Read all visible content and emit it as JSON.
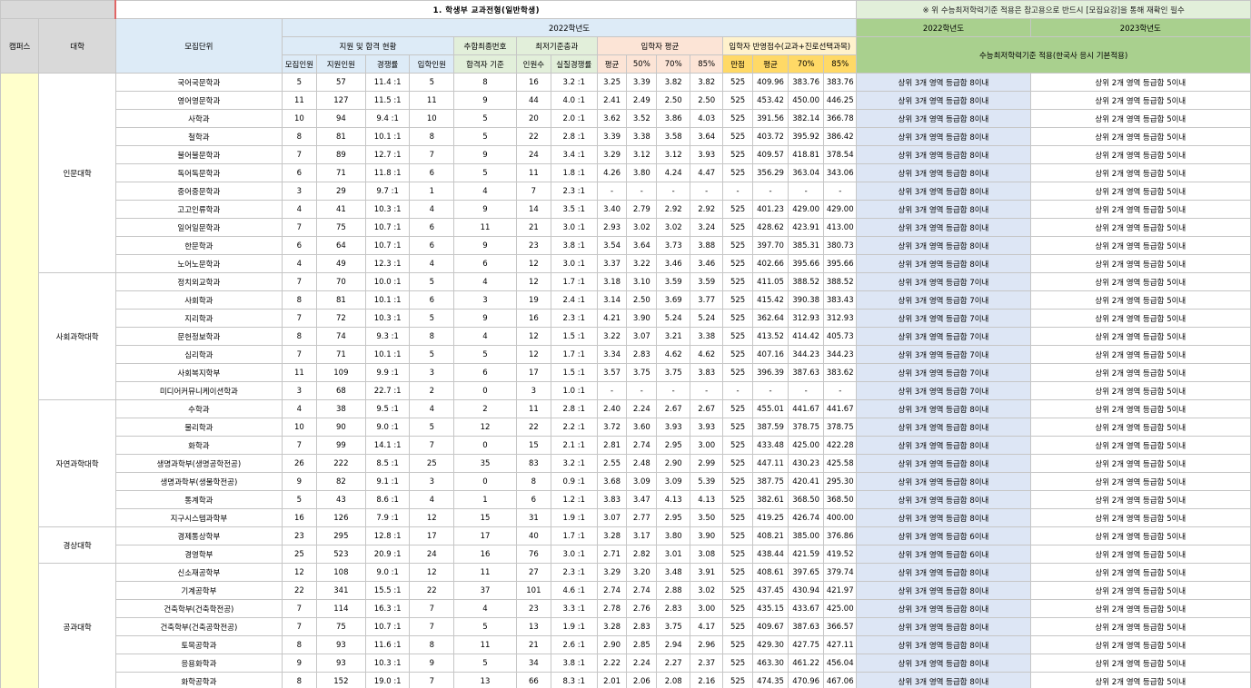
{
  "title": "1. 학생부 교과전형(일반학생)",
  "note": "※ 위 수능최저학력기준 적용은 참고용으로 반드시 [모집요강]을 통해 재확인 필수",
  "headers": {
    "campus": "캠퍼스",
    "college": "대학",
    "unit": "모집단위",
    "year2022": "2022학년도",
    "apply_group": "지원 및 합격 현황",
    "extra_group": "추합최종번호",
    "min_group": "최저기준충과",
    "avg_group": "입학자 평균",
    "score_group": "입학자 반영점수(교과+진로선택과목)",
    "recruit": "모집인원",
    "applicants": "지원인원",
    "ratio": "경쟁률",
    "admitted": "입학인원",
    "pass_base": "합격자 기준",
    "min_count": "인원수",
    "real_ratio": "실질경쟁률",
    "avg": "평균",
    "p50": "50%",
    "p70": "70%",
    "p85": "85%",
    "full": "만점",
    "savg": "평균",
    "s70": "70%",
    "s85": "85%",
    "csat2022": "2022학년도",
    "csat2023": "2023학년도",
    "csat_span": "수능최저학력기준 적용(한국사 응시 기본적용)"
  },
  "colleges": [
    {
      "name": "인문대학",
      "rows": [
        [
          "국어국문학과",
          "5",
          "57",
          "11.4 :1",
          "5",
          "8",
          "16",
          "3.2 :1",
          "3.25",
          "3.39",
          "3.82",
          "3.82",
          "525",
          "409.96",
          "383.76",
          "383.76",
          "상위 3개 영역 등급합 8이내",
          "상위 2개 영역 등급합 5이내"
        ],
        [
          "영어영문학과",
          "11",
          "127",
          "11.5 :1",
          "11",
          "9",
          "44",
          "4.0 :1",
          "2.41",
          "2.49",
          "2.50",
          "2.50",
          "525",
          "453.42",
          "450.00",
          "446.25",
          "상위 3개 영역 등급합 8이내",
          "상위 2개 영역 등급합 5이내"
        ],
        [
          "사학과",
          "10",
          "94",
          "9.4 :1",
          "10",
          "5",
          "20",
          "2.0 :1",
          "3.62",
          "3.52",
          "3.86",
          "4.03",
          "525",
          "391.56",
          "382.14",
          "366.78",
          "상위 3개 영역 등급합 8이내",
          "상위 2개 영역 등급합 5이내"
        ],
        [
          "철학과",
          "8",
          "81",
          "10.1 :1",
          "8",
          "5",
          "22",
          "2.8 :1",
          "3.39",
          "3.38",
          "3.58",
          "3.64",
          "525",
          "403.72",
          "395.92",
          "386.42",
          "상위 3개 영역 등급합 8이내",
          "상위 2개 영역 등급합 5이내"
        ],
        [
          "불어불문학과",
          "7",
          "89",
          "12.7 :1",
          "7",
          "9",
          "24",
          "3.4 :1",
          "3.29",
          "3.12",
          "3.12",
          "3.93",
          "525",
          "409.57",
          "418.81",
          "378.54",
          "상위 3개 영역 등급합 8이내",
          "상위 2개 영역 등급합 5이내"
        ],
        [
          "독어독문학과",
          "6",
          "71",
          "11.8 :1",
          "6",
          "5",
          "11",
          "1.8 :1",
          "4.26",
          "3.80",
          "4.24",
          "4.47",
          "525",
          "356.29",
          "363.04",
          "343.06",
          "상위 3개 영역 등급합 8이내",
          "상위 2개 영역 등급합 5이내"
        ],
        [
          "중어중문학과",
          "3",
          "29",
          "9.7 :1",
          "1",
          "4",
          "7",
          "2.3 :1",
          "-",
          "-",
          "-",
          "-",
          "-",
          "-",
          "-",
          "-",
          "상위 3개 영역 등급합 8이내",
          "상위 2개 영역 등급합 5이내"
        ],
        [
          "고고인류학과",
          "4",
          "41",
          "10.3 :1",
          "4",
          "9",
          "14",
          "3.5 :1",
          "3.40",
          "2.79",
          "2.92",
          "2.92",
          "525",
          "401.23",
          "429.00",
          "429.00",
          "상위 3개 영역 등급합 8이내",
          "상위 2개 영역 등급합 5이내"
        ],
        [
          "일어일문학과",
          "7",
          "75",
          "10.7 :1",
          "6",
          "11",
          "21",
          "3.0 :1",
          "2.93",
          "3.02",
          "3.02",
          "3.24",
          "525",
          "428.62",
          "423.91",
          "413.00",
          "상위 3개 영역 등급합 8이내",
          "상위 2개 영역 등급합 5이내"
        ],
        [
          "한문학과",
          "6",
          "64",
          "10.7 :1",
          "6",
          "9",
          "23",
          "3.8 :1",
          "3.54",
          "3.64",
          "3.73",
          "3.88",
          "525",
          "397.70",
          "385.31",
          "380.73",
          "상위 3개 영역 등급합 8이내",
          "상위 2개 영역 등급합 5이내"
        ],
        [
          "노어노문학과",
          "4",
          "49",
          "12.3 :1",
          "4",
          "6",
          "12",
          "3.0 :1",
          "3.37",
          "3.22",
          "3.46",
          "3.46",
          "525",
          "402.66",
          "395.66",
          "395.66",
          "상위 3개 영역 등급합 8이내",
          "상위 2개 영역 등급합 5이내"
        ]
      ]
    },
    {
      "name": "사회과학대학",
      "rows": [
        [
          "정치외교학과",
          "7",
          "70",
          "10.0 :1",
          "5",
          "4",
          "12",
          "1.7 :1",
          "3.18",
          "3.10",
          "3.59",
          "3.59",
          "525",
          "411.05",
          "388.52",
          "388.52",
          "상위 3개 영역 등급합 7이내",
          "상위 2개 영역 등급합 5이내"
        ],
        [
          "사회학과",
          "8",
          "81",
          "10.1 :1",
          "6",
          "3",
          "19",
          "2.4 :1",
          "3.14",
          "2.50",
          "3.69",
          "3.77",
          "525",
          "415.42",
          "390.38",
          "383.43",
          "상위 3개 영역 등급합 7이내",
          "상위 2개 영역 등급합 5이내"
        ],
        [
          "지리학과",
          "7",
          "72",
          "10.3 :1",
          "5",
          "9",
          "16",
          "2.3 :1",
          "4.21",
          "3.90",
          "5.24",
          "5.24",
          "525",
          "362.64",
          "312.93",
          "312.93",
          "상위 3개 영역 등급합 7이내",
          "상위 2개 영역 등급합 5이내"
        ],
        [
          "문헌정보학과",
          "8",
          "74",
          "9.3 :1",
          "8",
          "4",
          "12",
          "1.5 :1",
          "3.22",
          "3.07",
          "3.21",
          "3.38",
          "525",
          "413.52",
          "414.42",
          "405.73",
          "상위 3개 영역 등급합 7이내",
          "상위 2개 영역 등급합 5이내"
        ],
        [
          "심리학과",
          "7",
          "71",
          "10.1 :1",
          "5",
          "5",
          "12",
          "1.7 :1",
          "3.34",
          "2.83",
          "4.62",
          "4.62",
          "525",
          "407.16",
          "344.23",
          "344.23",
          "상위 3개 영역 등급합 7이내",
          "상위 2개 영역 등급합 5이내"
        ],
        [
          "사회복지학부",
          "11",
          "109",
          "9.9 :1",
          "3",
          "6",
          "17",
          "1.5 :1",
          "3.57",
          "3.75",
          "3.75",
          "3.83",
          "525",
          "396.39",
          "387.63",
          "383.62",
          "상위 3개 영역 등급합 7이내",
          "상위 2개 영역 등급합 5이내"
        ],
        [
          "미디어커뮤니케이션학과",
          "3",
          "68",
          "22.7 :1",
          "2",
          "0",
          "3",
          "1.0 :1",
          "-",
          "-",
          "-",
          "-",
          "-",
          "-",
          "-",
          "-",
          "상위 3개 영역 등급합 7이내",
          "상위 2개 영역 등급합 5이내"
        ]
      ]
    },
    {
      "name": "자연과학대학",
      "rows": [
        [
          "수학과",
          "4",
          "38",
          "9.5 :1",
          "4",
          "2",
          "11",
          "2.8 :1",
          "2.40",
          "2.24",
          "2.67",
          "2.67",
          "525",
          "455.01",
          "441.67",
          "441.67",
          "상위 3개 영역 등급합 8이내",
          "상위 2개 영역 등급합 5이내"
        ],
        [
          "물리학과",
          "10",
          "90",
          "9.0 :1",
          "5",
          "12",
          "22",
          "2.2 :1",
          "3.72",
          "3.60",
          "3.93",
          "3.93",
          "525",
          "387.59",
          "378.75",
          "378.75",
          "상위 3개 영역 등급합 8이내",
          "상위 2개 영역 등급합 5이내"
        ],
        [
          "화학과",
          "7",
          "99",
          "14.1 :1",
          "7",
          "0",
          "15",
          "2.1 :1",
          "2.81",
          "2.74",
          "2.95",
          "3.00",
          "525",
          "433.48",
          "425.00",
          "422.28",
          "상위 3개 영역 등급합 8이내",
          "상위 2개 영역 등급합 5이내"
        ],
        [
          "생명과학부(생명공학전공)",
          "26",
          "222",
          "8.5 :1",
          "25",
          "35",
          "83",
          "3.2 :1",
          "2.55",
          "2.48",
          "2.90",
          "2.99",
          "525",
          "447.11",
          "430.23",
          "425.58",
          "상위 3개 영역 등급합 8이내",
          "상위 2개 영역 등급합 5이내"
        ],
        [
          "생명과학부(생물학전공)",
          "9",
          "82",
          "9.1 :1",
          "3",
          "0",
          "8",
          "0.9 :1",
          "3.68",
          "3.09",
          "3.09",
          "5.39",
          "525",
          "387.75",
          "420.41",
          "295.30",
          "상위 3개 영역 등급합 8이내",
          "상위 2개 영역 등급합 5이내"
        ],
        [
          "통계학과",
          "5",
          "43",
          "8.6 :1",
          "4",
          "1",
          "6",
          "1.2 :1",
          "3.83",
          "3.47",
          "4.13",
          "4.13",
          "525",
          "382.61",
          "368.50",
          "368.50",
          "상위 3개 영역 등급합 8이내",
          "상위 2개 영역 등급합 5이내"
        ],
        [
          "지구시스템과학부",
          "16",
          "126",
          "7.9 :1",
          "12",
          "15",
          "31",
          "1.9 :1",
          "3.07",
          "2.77",
          "2.95",
          "3.50",
          "525",
          "419.25",
          "426.74",
          "400.00",
          "상위 3개 영역 등급합 8이내",
          "상위 2개 영역 등급합 5이내"
        ]
      ]
    },
    {
      "name": "경상대학",
      "rows": [
        [
          "경제통상학부",
          "23",
          "295",
          "12.8 :1",
          "17",
          "17",
          "40",
          "1.7 :1",
          "3.28",
          "3.17",
          "3.80",
          "3.90",
          "525",
          "408.21",
          "385.00",
          "376.86",
          "상위 3개 영역 등급합 6이내",
          "상위 2개 영역 등급합 5이내"
        ],
        [
          "경영학부",
          "25",
          "523",
          "20.9 :1",
          "24",
          "16",
          "76",
          "3.0 :1",
          "2.71",
          "2.82",
          "3.01",
          "3.08",
          "525",
          "438.44",
          "421.59",
          "419.52",
          "상위 3개 영역 등급합 6이내",
          "상위 2개 영역 등급합 5이내"
        ]
      ]
    },
    {
      "name": "공과대학",
      "rows": [
        [
          "신소재공학부",
          "12",
          "108",
          "9.0 :1",
          "12",
          "11",
          "27",
          "2.3 :1",
          "3.29",
          "3.20",
          "3.48",
          "3.91",
          "525",
          "408.61",
          "397.65",
          "379.74",
          "상위 3개 영역 등급합 8이내",
          "상위 2개 영역 등급합 5이내"
        ],
        [
          "기계공학부",
          "22",
          "341",
          "15.5 :1",
          "22",
          "37",
          "101",
          "4.6 :1",
          "2.74",
          "2.74",
          "2.88",
          "3.02",
          "525",
          "437.45",
          "430.94",
          "421.97",
          "상위 3개 영역 등급합 8이내",
          "상위 2개 영역 등급합 5이내"
        ],
        [
          "건축학부(건축학전공)",
          "7",
          "114",
          "16.3 :1",
          "7",
          "4",
          "23",
          "3.3 :1",
          "2.78",
          "2.76",
          "2.83",
          "3.00",
          "525",
          "435.15",
          "433.67",
          "425.00",
          "상위 3개 영역 등급합 8이내",
          "상위 2개 영역 등급합 5이내"
        ],
        [
          "건축학부(건축공학전공)",
          "7",
          "75",
          "10.7 :1",
          "7",
          "5",
          "13",
          "1.9 :1",
          "3.28",
          "2.83",
          "3.75",
          "4.17",
          "525",
          "409.67",
          "387.63",
          "366.57",
          "상위 3개 영역 등급합 8이내",
          "상위 2개 영역 등급합 5이내"
        ],
        [
          "토목공학과",
          "8",
          "93",
          "11.6 :1",
          "8",
          "11",
          "21",
          "2.6 :1",
          "2.90",
          "2.85",
          "2.94",
          "2.96",
          "525",
          "429.30",
          "427.75",
          "427.11",
          "상위 3개 영역 등급합 8이내",
          "상위 2개 영역 등급합 5이내"
        ],
        [
          "응용화학과",
          "9",
          "93",
          "10.3 :1",
          "9",
          "5",
          "34",
          "3.8 :1",
          "2.22",
          "2.24",
          "2.27",
          "2.37",
          "525",
          "463.30",
          "461.22",
          "456.04",
          "상위 3개 영역 등급합 8이내",
          "상위 2개 영역 등급합 5이내"
        ],
        [
          "화학공학과",
          "8",
          "152",
          "19.0 :1",
          "7",
          "13",
          "66",
          "8.3 :1",
          "2.01",
          "2.06",
          "2.08",
          "2.16",
          "525",
          "474.35",
          "470.96",
          "467.06",
          "상위 3개 영역 등급합 8이내",
          "상위 2개 영역 등급합 5이내"
        ]
      ]
    }
  ]
}
